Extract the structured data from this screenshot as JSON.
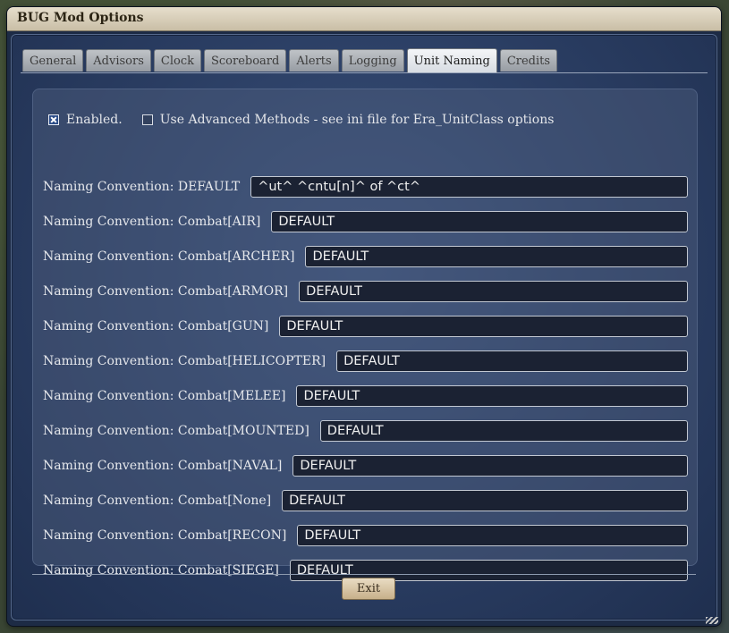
{
  "window": {
    "title": "BUG Mod Options"
  },
  "tabs": [
    {
      "label": "General",
      "active": false
    },
    {
      "label": "Advisors",
      "active": false
    },
    {
      "label": "Clock",
      "active": false
    },
    {
      "label": "Scoreboard",
      "active": false
    },
    {
      "label": "Alerts",
      "active": false
    },
    {
      "label": "Logging",
      "active": false
    },
    {
      "label": "Unit Naming",
      "active": true
    },
    {
      "label": "Credits",
      "active": false
    }
  ],
  "options": {
    "enabled": {
      "label": "Enabled.",
      "checked": true
    },
    "advanced": {
      "label": "Use Advanced Methods - see ini file for Era_UnitClass options",
      "checked": false
    }
  },
  "conventions": [
    {
      "label": "Naming Convention: DEFAULT",
      "value": "^ut^ ^cntu[n]^ of ^ct^"
    },
    {
      "label": "Naming Convention: Combat[AIR]",
      "value": "DEFAULT"
    },
    {
      "label": "Naming Convention: Combat[ARCHER]",
      "value": "DEFAULT"
    },
    {
      "label": "Naming Convention: Combat[ARMOR]",
      "value": "DEFAULT"
    },
    {
      "label": "Naming Convention: Combat[GUN]",
      "value": "DEFAULT"
    },
    {
      "label": "Naming Convention: Combat[HELICOPTER]",
      "value": "DEFAULT"
    },
    {
      "label": "Naming Convention: Combat[MELEE]",
      "value": "DEFAULT"
    },
    {
      "label": "Naming Convention: Combat[MOUNTED]",
      "value": "DEFAULT"
    },
    {
      "label": "Naming Convention: Combat[NAVAL]",
      "value": "DEFAULT"
    },
    {
      "label": "Naming Convention: Combat[None]",
      "value": "DEFAULT"
    },
    {
      "label": "Naming Convention: Combat[RECON]",
      "value": "DEFAULT"
    },
    {
      "label": "Naming Convention: Combat[SIEGE]",
      "value": "DEFAULT"
    }
  ],
  "footer": {
    "exit_label": "Exit"
  }
}
